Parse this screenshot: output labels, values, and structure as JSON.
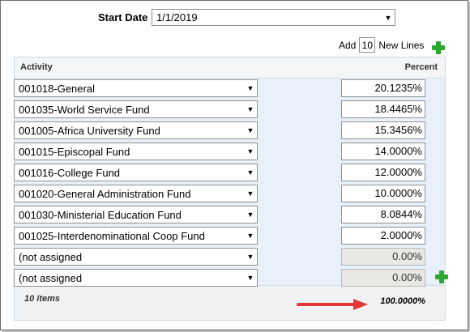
{
  "form": {
    "start_date_label": "Start Date",
    "start_date_value": "1/1/2019",
    "add_label": "Add",
    "add_count": "10",
    "new_lines_label": "New Lines"
  },
  "table": {
    "columns": [
      "Activity",
      "Percent"
    ],
    "rows": [
      {
        "activity": "001018-General",
        "percent": "20.1235%"
      },
      {
        "activity": "001035-World Service Fund",
        "percent": "18.4465%"
      },
      {
        "activity": "001005-Africa University Fund",
        "percent": "15.3456%"
      },
      {
        "activity": "001015-Episcopal Fund",
        "percent": "14.0000%"
      },
      {
        "activity": "001016-College Fund",
        "percent": "12.0000%"
      },
      {
        "activity": "001020-General Administration Fund",
        "percent": "10.0000%"
      },
      {
        "activity": "001030-Ministerial Education Fund",
        "percent": "8.0844%"
      },
      {
        "activity": "001025-Interdenominational Coop Fund",
        "percent": "2.0000%"
      },
      {
        "activity": "(not assigned",
        "percent": "0.00%"
      },
      {
        "activity": "(not assigned",
        "percent": "0.00%"
      }
    ],
    "footer_count": "10 items",
    "footer_total": "100.0000%"
  },
  "colors": {
    "add_icon": "#2ea82e",
    "annotation_arrow": "#e53935",
    "grid_background": "#e8f1fb"
  },
  "icons": {
    "add": "plus-icon",
    "dropdown": "chevron-down-icon",
    "annotation": "arrow-right-icon"
  }
}
